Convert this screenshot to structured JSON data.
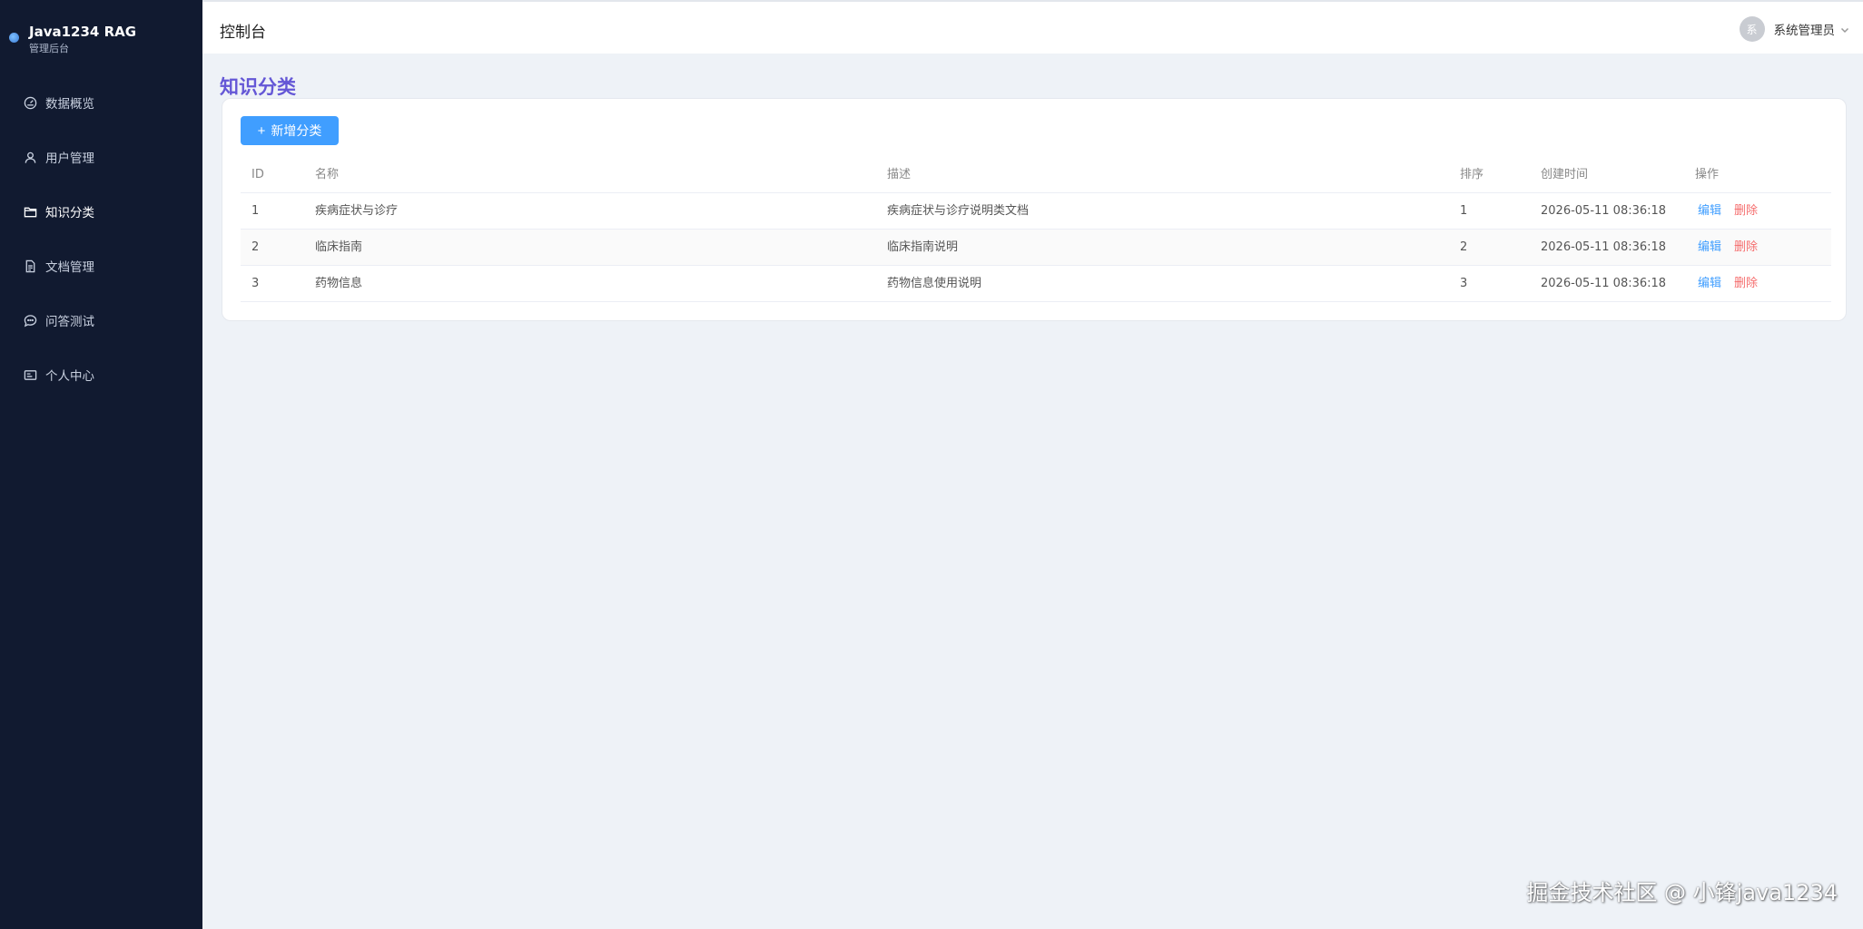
{
  "brand": {
    "title": "Java1234 RAG",
    "subtitle": "管理后台"
  },
  "sidebar": {
    "items": [
      {
        "label": "数据概览",
        "icon": "gauge-icon"
      },
      {
        "label": "用户管理",
        "icon": "user-icon"
      },
      {
        "label": "知识分类",
        "icon": "folder-icon",
        "active": true
      },
      {
        "label": "文档管理",
        "icon": "document-icon"
      },
      {
        "label": "问答测试",
        "icon": "chat-icon"
      },
      {
        "label": "个人中心",
        "icon": "id-card-icon"
      }
    ]
  },
  "header": {
    "title": "控制台"
  },
  "user": {
    "avatar_text": "系",
    "name": "系统管理员"
  },
  "page": {
    "title": "知识分类"
  },
  "toolbar": {
    "add_label": "新增分类"
  },
  "table": {
    "columns": [
      "ID",
      "名称",
      "描述",
      "排序",
      "创建时间",
      "操作"
    ],
    "rows": [
      {
        "id": "1",
        "name": "疾病症状与诊疗",
        "desc": "疾病症状与诊疗说明类文档",
        "sort": "1",
        "created": "2026-05-11 08:36:18"
      },
      {
        "id": "2",
        "name": "临床指南",
        "desc": "临床指南说明",
        "sort": "2",
        "created": "2026-05-11 08:36:18"
      },
      {
        "id": "3",
        "name": "药物信息",
        "desc": "药物信息使用说明",
        "sort": "3",
        "created": "2026-05-11 08:36:18"
      }
    ],
    "actions": {
      "edit": "编辑",
      "delete": "删除"
    }
  },
  "watermark": "掘金技术社区 @ 小锋java1234",
  "colors": {
    "sidebar_bg": "#111a30",
    "primary": "#409eff",
    "danger": "#f56c6c",
    "page_title": "#6457d6",
    "page_bg": "#eef2f7"
  }
}
